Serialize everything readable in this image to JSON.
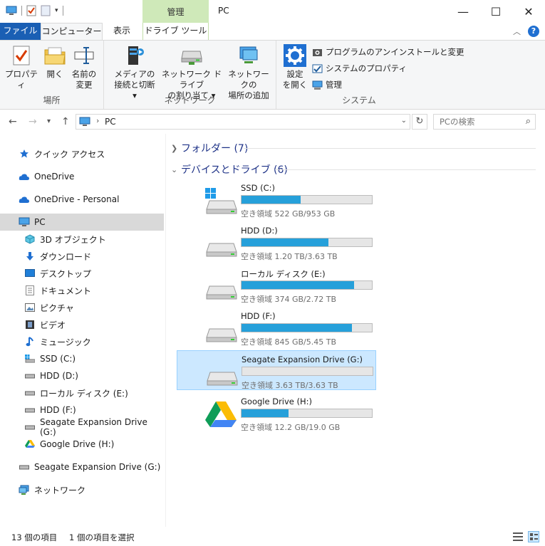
{
  "window": {
    "title": "PC",
    "context_tab": "管理",
    "minimize": "—",
    "maximize": "☐",
    "close": "✕"
  },
  "tabs": {
    "file": "ファイル",
    "computer": "コンピューター",
    "view": "表示",
    "drive_tools": "ドライブ ツール"
  },
  "ribbon": {
    "location": {
      "label": "場所",
      "properties": "プロパティ",
      "open": "開く",
      "rename_1": "名前の",
      "rename_2": "変更"
    },
    "network": {
      "label": "ネットワーク",
      "media_1": "メディアの",
      "media_2": "接続と切断 ▾",
      "netdrive_1": "ネットワーク ドライブ",
      "netdrive_2": "の割り当て ▾",
      "netloc_1": "ネットワークの",
      "netloc_2": "場所の追加"
    },
    "system": {
      "label": "システム",
      "settings_1": "設定",
      "settings_2": "を開く",
      "uninstall": "プログラムのアンインストールと変更",
      "sysprops": "システムのプロパティ",
      "manage": "管理"
    }
  },
  "address": {
    "path": "PC",
    "search_placeholder": "PCの検索"
  },
  "sidebar": {
    "quick_access": "クイック アクセス",
    "onedrive": "OneDrive",
    "onedrive_personal": "OneDrive - Personal",
    "pc": "PC",
    "objects3d": "3D オブジェクト",
    "downloads": "ダウンロード",
    "desktop": "デスクトップ",
    "documents": "ドキュメント",
    "pictures": "ピクチャ",
    "videos": "ビデオ",
    "music": "ミュージック",
    "ssd": "SSD (C:)",
    "hdd_d": "HDD (D:)",
    "local_e": "ローカル ディスク (E:)",
    "hdd_f": "HDD (F:)",
    "seagate_g": "Seagate Expansion Drive (G:)",
    "gdrive_h": "Google Drive (H:)",
    "seagate_g2": "Seagate Expansion Drive (G:)",
    "network": "ネットワーク"
  },
  "content": {
    "folders_header": "フォルダー (7)",
    "devices_header": "デバイスとドライブ (6)",
    "drives": [
      {
        "name": "SSD (C:)",
        "free": "空き領域 522 GB/953 GB",
        "used_fraction": 0.452,
        "icon": "windows-drive"
      },
      {
        "name": "HDD (D:)",
        "free": "空き領域 1.20 TB/3.63 TB",
        "used_fraction": 0.669,
        "icon": "hard-drive"
      },
      {
        "name": "ローカル ディスク (E:)",
        "free": "空き領域 374 GB/2.72 TB",
        "used_fraction": 0.866,
        "icon": "hard-drive"
      },
      {
        "name": "HDD (F:)",
        "free": "空き領域 845 GB/5.45 TB",
        "used_fraction": 0.849,
        "icon": "hard-drive"
      },
      {
        "name": "Seagate Expansion Drive (G:)",
        "free": "空き領域 3.63 TB/3.63 TB",
        "used_fraction": 0.0,
        "icon": "hard-drive"
      },
      {
        "name": "Google Drive (H:)",
        "free": "空き領域 12.2 GB/19.0 GB",
        "used_fraction": 0.358,
        "icon": "google-drive"
      }
    ]
  },
  "status": {
    "items": "13 個の項目",
    "selected": "1 個の項目を選択"
  }
}
